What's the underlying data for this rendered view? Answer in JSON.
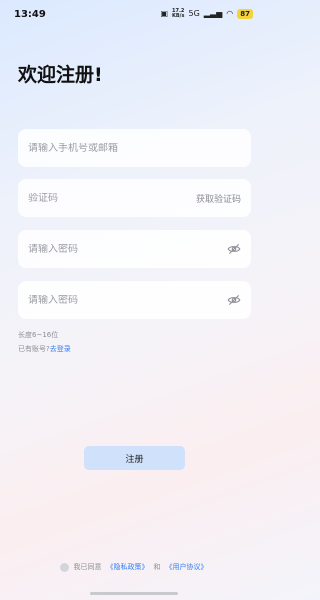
{
  "status_bar": {
    "time": "13:49",
    "net_speed_value": "17.2",
    "net_speed_unit": "KB/s",
    "signal_label": "5G",
    "battery": "87",
    "accent": "#f2d43a"
  },
  "page": {
    "title": "欢迎注册!"
  },
  "form": {
    "account_placeholder": "请输入手机号或邮箱",
    "code_placeholder": "验证码",
    "get_code_label": "获取验证码",
    "password_placeholder": "请输入密码",
    "confirm_password_placeholder": "请输入密码",
    "length_hint": "长度6~16位",
    "have_account_text": "已有账号?",
    "login_link": "去登录"
  },
  "register_button": {
    "label": "注册",
    "color": "#cfe1fb"
  },
  "agreement": {
    "prefix": "我已同意",
    "privacy_link": "《隐私政策》",
    "and": "和",
    "user_link": "《用户协议》",
    "link_color": "#2f7df6"
  }
}
